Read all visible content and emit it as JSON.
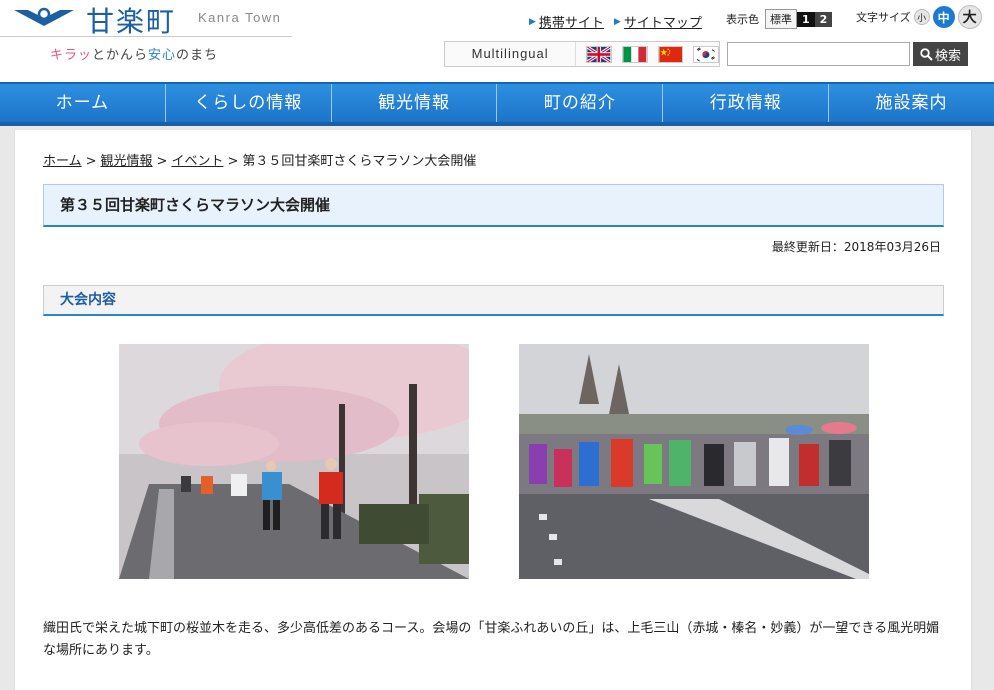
{
  "header": {
    "logo_title": "甘楽町",
    "logo_sub": "Kanra Town",
    "tagline": {
      "part1": "キラッ",
      "part2": "とかんら",
      "part3": "安心",
      "part4": "のまち"
    },
    "links": [
      {
        "label": "携帯サイト"
      },
      {
        "label": "サイトマップ"
      }
    ],
    "color_label": "表示色",
    "color_options": {
      "standard": "標準",
      "opt1": "1",
      "opt2": "2"
    },
    "size_label": "文字サイズ",
    "size_options": {
      "small": "小",
      "medium": "中",
      "large": "大"
    },
    "multilingual": "Multilingual",
    "search_placeholder": "",
    "search_button": "検索"
  },
  "nav": [
    "ホーム",
    "くらしの情報",
    "観光情報",
    "町の紹介",
    "行政情報",
    "施設案内"
  ],
  "breadcrumb": {
    "home": "ホーム",
    "sightseeing": "観光情報",
    "event": "イベント",
    "current": "第３５回甘楽町さくらマラソン大会開催",
    "sep": ">"
  },
  "page": {
    "title": "第３５回甘楽町さくらマラソン大会開催",
    "updated": "最終更新日：2018年03月26日",
    "section1": "大会内容",
    "body": "織田氏で栄えた城下町の桜並木を走る、多少高低差のあるコース。会場の「甘楽ふれあいの丘」は、上毛三山（赤城・榛名・妙義）が一望できる風光明媚な場所にあります。"
  },
  "colors": {
    "accent": "#2a84c9",
    "nav": "#1c74c9",
    "logo": "#1c5fa3"
  }
}
